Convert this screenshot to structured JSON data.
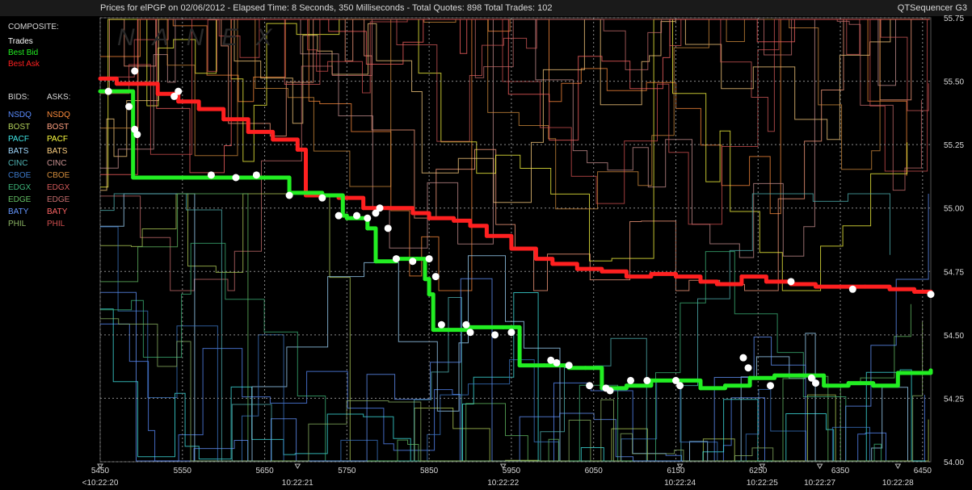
{
  "header": {
    "title": "Prices for  elPGP  on  02/06/2012  -  Elapsed Time: 8 Seconds, 350 Milliseconds  -  Total Quotes: 898  Total Trades: 102",
    "brand": "QTSequencer G3"
  },
  "watermark": "NANEX",
  "legend": {
    "composite_label": "COMPOSITE:",
    "composite": [
      {
        "label": "Trades",
        "color": "#ffffff"
      },
      {
        "label": "Best Bid",
        "color": "#22ee22"
      },
      {
        "label": "Best Ask",
        "color": "#ff2020"
      }
    ],
    "bids_label": "BIDS:",
    "asks_label": "ASKS:",
    "exchanges": [
      {
        "bid": "NSDQ",
        "ask": "NSDQ",
        "bid_color": "#5a8cff",
        "ask_color": "#ff8c3c"
      },
      {
        "bid": "BOST",
        "ask": "BOST",
        "bid_color": "#b4d25a",
        "ask_color": "#ffa080"
      },
      {
        "bid": "PACF",
        "ask": "PACF",
        "bid_color": "#40e8e8",
        "ask_color": "#ffff40"
      },
      {
        "bid": "BATS",
        "ask": "BATS",
        "bid_color": "#a0d8ff",
        "ask_color": "#ffd080"
      },
      {
        "bid": "CINC",
        "ask": "CINC",
        "bid_color": "#50b4b4",
        "ask_color": "#c89090"
      },
      {
        "bid": "CBOE",
        "ask": "CBOE",
        "bid_color": "#3c78c8",
        "ask_color": "#d28c3c"
      },
      {
        "bid": "EDGX",
        "ask": "EDGX",
        "bid_color": "#3cb478",
        "ask_color": "#d25a5a"
      },
      {
        "bid": "EDGE",
        "ask": "EDGE",
        "bid_color": "#64be64",
        "ask_color": "#c86e6e"
      },
      {
        "bid": "BATY",
        "ask": "BATY",
        "bid_color": "#6496ff",
        "ask_color": "#ff6464"
      },
      {
        "bid": "PHIL",
        "ask": "PHIL",
        "bid_color": "#8cb464",
        "ask_color": "#d25050"
      }
    ]
  },
  "chart_data": {
    "type": "line",
    "grid": true,
    "ylim": [
      54.0,
      55.75
    ],
    "y_ticks": [
      "55.75",
      "55.50",
      "55.25",
      "55.00",
      "54.75",
      "54.50",
      "54.25",
      "54.00"
    ],
    "xlim": [
      5450,
      6460
    ],
    "x_ticks": [
      "5450",
      "5550",
      "5650",
      "5750",
      "5850",
      "5950",
      "6050",
      "6150",
      "6250",
      "6350",
      "6450"
    ],
    "time_ticks": [
      {
        "x": 5450,
        "label": "<10:22:20"
      },
      {
        "x": 5690,
        "label": "10:22:21"
      },
      {
        "x": 5940,
        "label": "10:22:22"
      },
      {
        "x": 6155,
        "label": "10:22:24"
      },
      {
        "x": 6255,
        "label": "10:22:25"
      },
      {
        "x": 6325,
        "label": "10:22:27"
      },
      {
        "x": 6420,
        "label": "10:22:28"
      }
    ],
    "series": [
      {
        "name": "Best Ask",
        "color": "#ff2020",
        "x": [
          5450,
          5470,
          5490,
          5520,
          5545,
          5570,
          5600,
          5630,
          5660,
          5690,
          5700,
          5740,
          5770,
          5800,
          5830,
          5850,
          5880,
          5900,
          5920,
          5950,
          5980,
          6000,
          6030,
          6060,
          6090,
          6120,
          6150,
          6180,
          6200,
          6230,
          6260,
          6290,
          6320,
          6350,
          6380,
          6410,
          6440,
          6460
        ],
        "y": [
          55.51,
          55.49,
          55.49,
          55.45,
          55.42,
          55.39,
          55.35,
          55.3,
          55.27,
          55.23,
          55.05,
          55.04,
          55.0,
          55.0,
          54.98,
          54.96,
          54.95,
          54.93,
          54.89,
          54.84,
          54.8,
          54.78,
          54.76,
          54.75,
          54.73,
          54.74,
          54.73,
          54.71,
          54.7,
          54.73,
          54.71,
          54.7,
          54.69,
          54.69,
          54.69,
          54.68,
          54.67,
          54.67
        ]
      },
      {
        "name": "Best Bid",
        "color": "#22ee22",
        "x": [
          5450,
          5460,
          5490,
          5520,
          5560,
          5600,
          5640,
          5675,
          5680,
          5720,
          5745,
          5750,
          5775,
          5785,
          5810,
          5835,
          5845,
          5850,
          5855,
          5900,
          5940,
          5960,
          5990,
          6020,
          6040,
          6060,
          6090,
          6120,
          6150,
          6180,
          6210,
          6240,
          6270,
          6300,
          6330,
          6360,
          6390,
          6420,
          6460
        ],
        "y": [
          55.46,
          55.46,
          55.12,
          55.12,
          55.12,
          55.12,
          55.12,
          55.12,
          55.06,
          55.05,
          54.97,
          54.96,
          54.92,
          54.79,
          54.8,
          54.8,
          54.72,
          54.66,
          54.52,
          54.53,
          54.53,
          54.38,
          54.38,
          54.37,
          54.37,
          54.29,
          54.3,
          54.32,
          54.32,
          54.29,
          54.3,
          54.33,
          54.34,
          54.34,
          54.3,
          54.31,
          54.3,
          54.35,
          54.36
        ]
      },
      {
        "name": "Trades",
        "color": "#ffffff",
        "x": [
          5460,
          5485,
          5492,
          5492,
          5495,
          5540,
          5545,
          5585,
          5615,
          5640,
          5680,
          5720,
          5740,
          5762,
          5775,
          5785,
          5790,
          5800,
          5810,
          5830,
          5850,
          5858,
          5865,
          5895,
          5900,
          5930,
          5950,
          5998,
          6005,
          6020,
          6045,
          6065,
          6070,
          6095,
          6115,
          6150,
          6155,
          6232,
          6238,
          6265,
          6290,
          6315,
          6320,
          6365,
          6460
        ],
        "y": [
          55.46,
          55.4,
          55.54,
          55.31,
          55.29,
          55.44,
          55.46,
          55.13,
          55.12,
          55.13,
          55.05,
          55.04,
          54.97,
          54.97,
          54.96,
          54.98,
          55.0,
          54.92,
          54.8,
          54.79,
          54.8,
          54.73,
          54.54,
          54.54,
          54.51,
          54.5,
          54.51,
          54.4,
          54.39,
          54.38,
          54.3,
          54.29,
          54.28,
          54.32,
          54.32,
          54.32,
          54.3,
          54.41,
          54.37,
          54.3,
          54.71,
          54.33,
          54.31,
          54.68,
          54.66
        ]
      }
    ]
  }
}
